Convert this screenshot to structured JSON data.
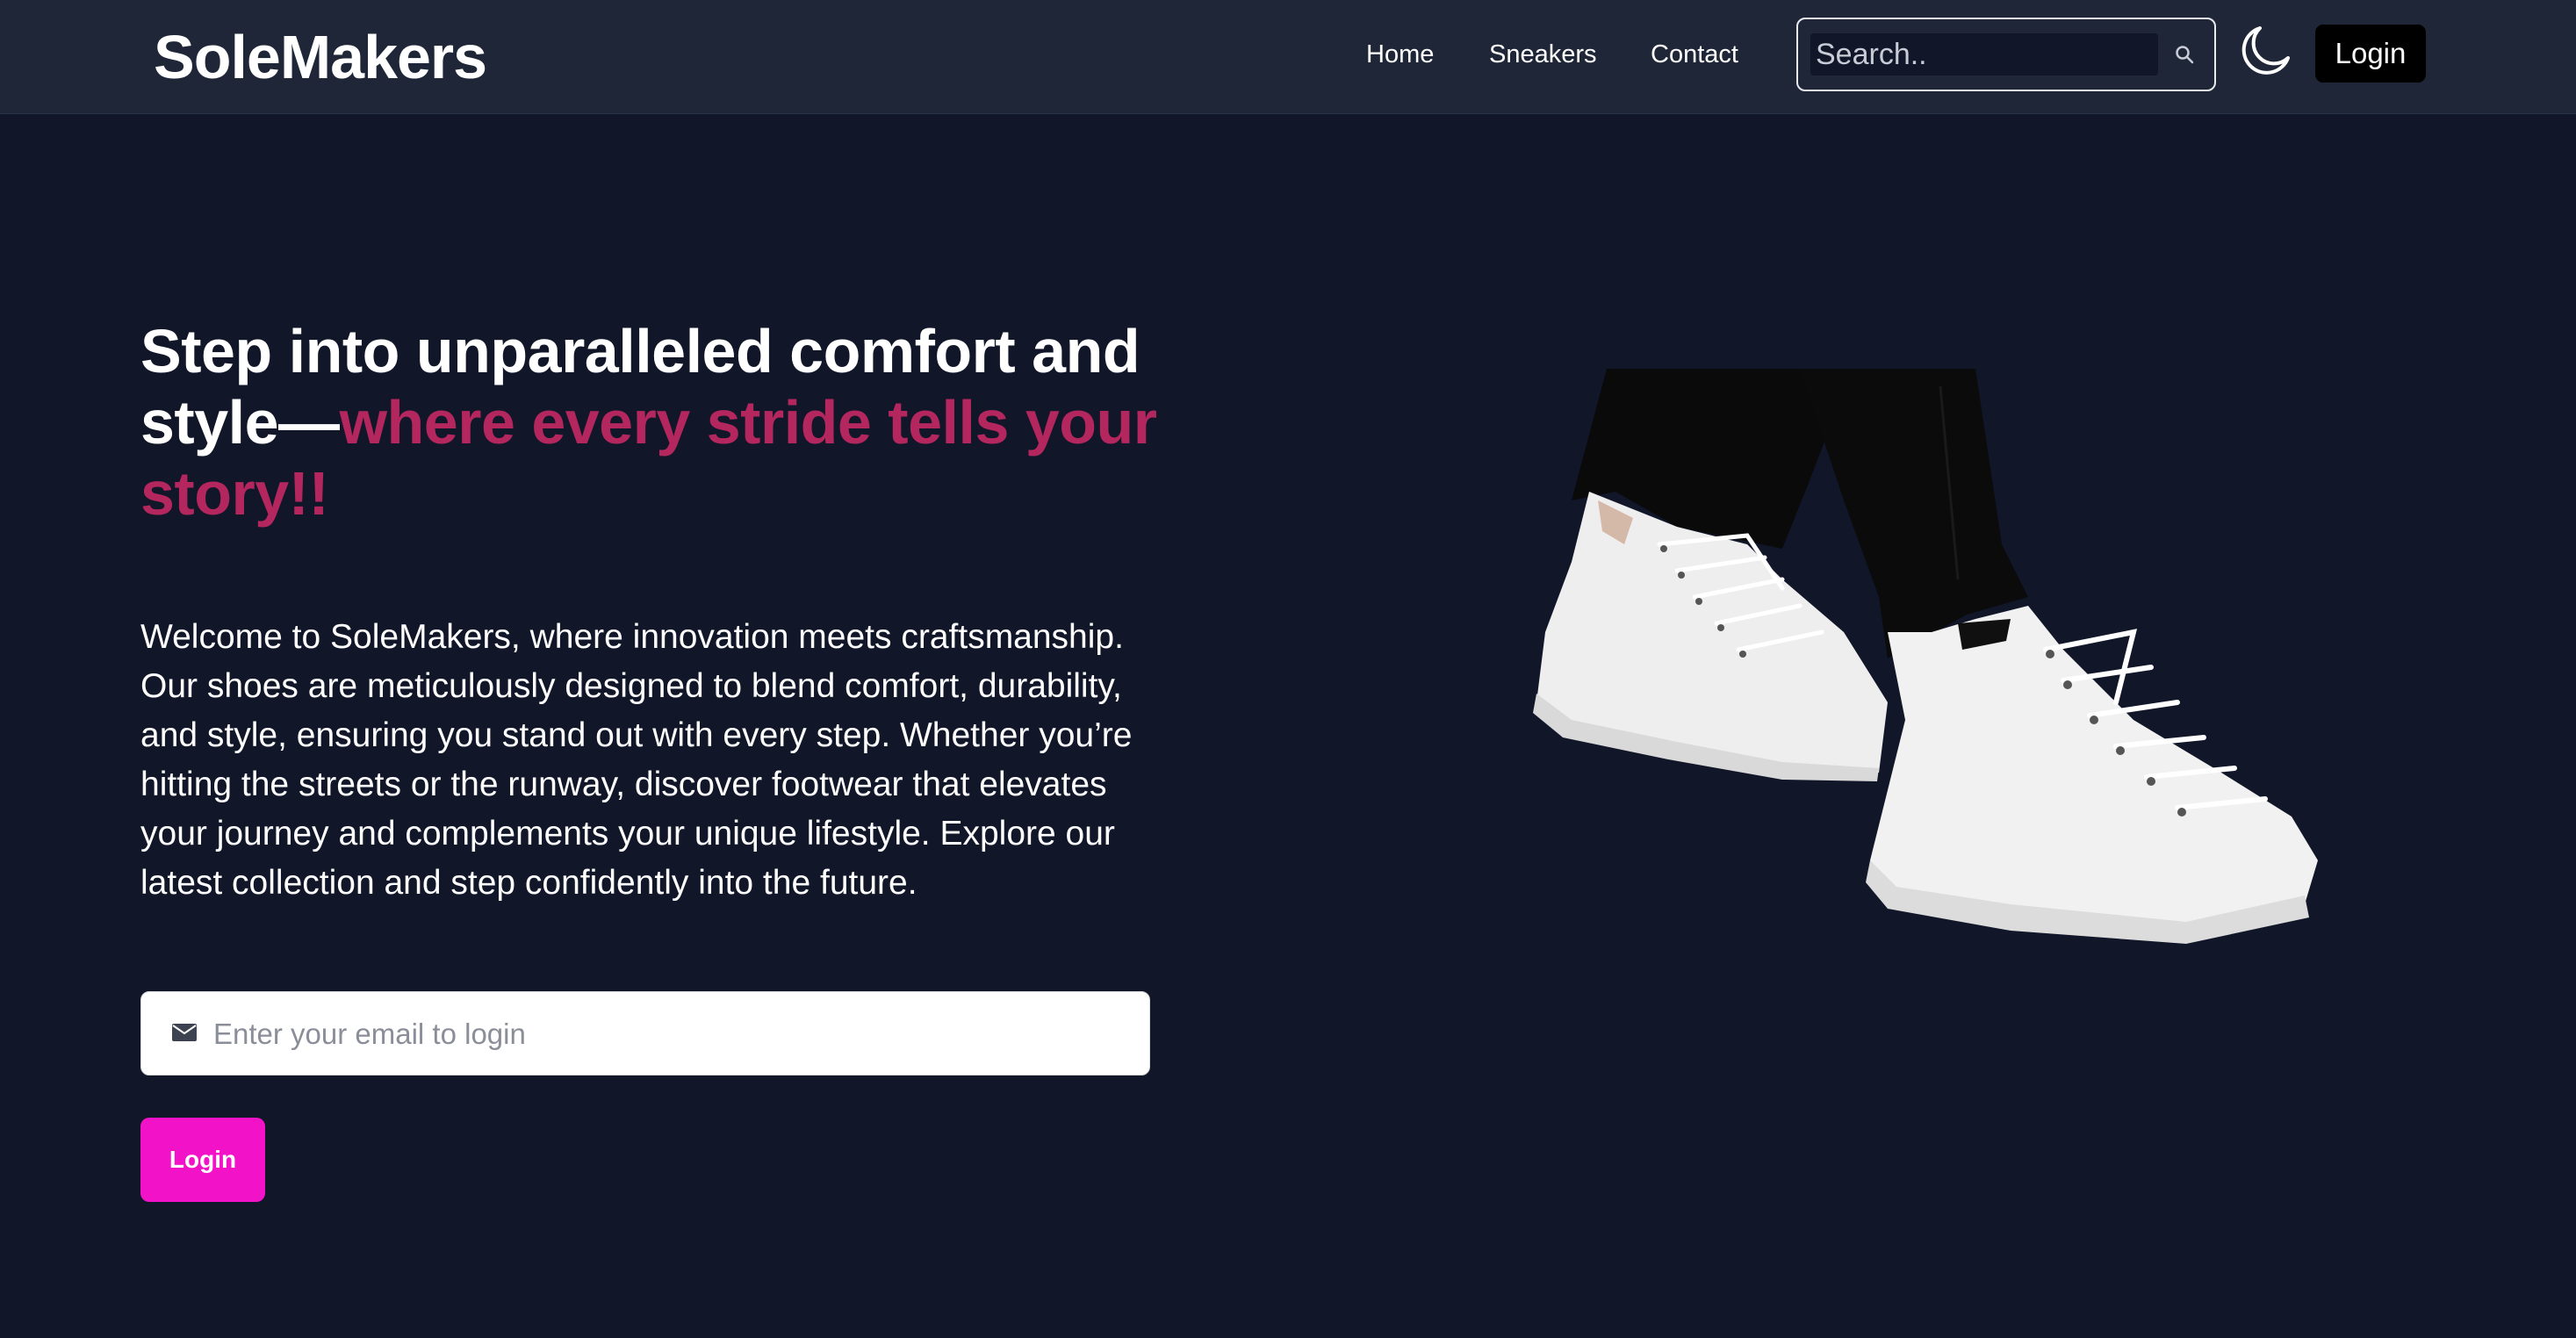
{
  "brand": {
    "name": "SoleMakers"
  },
  "nav": {
    "links": [
      {
        "label": "Home"
      },
      {
        "label": "Sneakers"
      },
      {
        "label": "Contact"
      }
    ],
    "search_placeholder": "Search..",
    "search_value": "",
    "search_icon": "search-icon",
    "theme_icon": "moon-icon",
    "login_label": "Login"
  },
  "hero": {
    "title_start": "Step into unparalleled comfort and style—",
    "title_accent": "where every stride tells your story!!",
    "description": "Welcome to SoleMakers, where innovation meets craftsmanship. Our shoes are meticulously designed to blend comfort, durability, and style, ensuring you stand out with every step. Whether you’re hitting the streets or the runway, discover footwear that elevates your journey and complements your unique lifestyle. Explore our latest collection and step confidently into the future.",
    "email_placeholder": "Enter your email to login",
    "email_value": "",
    "email_icon": "envelope-icon",
    "login_label": "Login",
    "image_subject": "sneakers-photo"
  },
  "colors": {
    "page_bg": "#111629",
    "navbar_bg": "#1e2638",
    "accent_text": "#b4265e",
    "cta": "#f212c8",
    "nav_login_bg": "#000000"
  }
}
